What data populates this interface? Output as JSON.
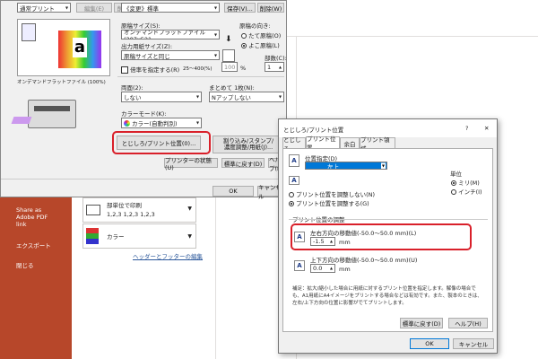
{
  "app": {
    "sidebar_items": [
      "Share as Adobe PDF link",
      "エクスポート",
      "閉じる"
    ],
    "print_options": [
      {
        "title": "部単位で印刷",
        "sub": "1,2,3   1,2,3   1,2,3"
      },
      {
        "title": "カラー",
        "sub": ""
      }
    ],
    "header_footer_link": "ヘッダーとフッターの編集"
  },
  "printer_dialog": {
    "top_select": "通常プリント",
    "edit_button": "編集(E)",
    "delete_button": "削除",
    "preset_select": "《変更》標準",
    "save_button": "保存(V)...",
    "delete2_button": "削除(W)",
    "paper_size_label": "原稿サイズ(S):",
    "paper_size_value": "オンデマンドフラットファイル (307x521",
    "orientation_label": "原稿の向き:",
    "orientation_portrait": "たて原稿(O)",
    "orientation_landscape": "よこ原稿(L)",
    "output_size_label": "出力用紙サイズ(Z):",
    "output_size_value": "原稿サイズと同じ",
    "scale_checkbox": "倍率を指定する(R)",
    "scale_range": "25〜400(%)",
    "scale_value": "100",
    "scale_unit": "%",
    "copies_label": "部数(C):",
    "copies_value": "1",
    "preview_caption": "オンデマンドフラットファイル (100%)",
    "duplex_label": "両面(2):",
    "duplex_value": "しない",
    "nup_label": "まとめて 1枚(N):",
    "nup_value": "Nアップしない",
    "color_mode_label": "カラーモード(K):",
    "color_mode_value": "カラー(自動判別)",
    "binding_button": "とじしろ/プリント位置(0)...",
    "stamp_button": "割り込み/スタンプ/\n濃度調整/用紙(J)...",
    "printer_status_button": "プリンターの状態(U)",
    "reset_button": "標準に戻す(D)",
    "help_button": "ヘルプ(H)",
    "ok_button": "OK",
    "cancel_button": "キャンセル"
  },
  "binding_dialog": {
    "title": "とじしろ/プリント位置",
    "help_glyph": "?",
    "close_glyph": "✕",
    "tabs": [
      "とじしろ",
      "プリント位置",
      "余白",
      "プリント領域"
    ],
    "active_tab": 1,
    "position_label": "位置指定(D)",
    "position_value": "左上",
    "unit_label": "単位",
    "unit_mm": "ミリ(M)",
    "unit_inch": "インチ(I)",
    "no_adjust": "プリント位置を調整しない(N)",
    "adjust": "プリント位置を調整する(G)",
    "adjust_group": "プリント位置の調整",
    "horizontal_label": "左右方向の移動値(-50.0〜50.0 mm)(L)",
    "horizontal_value": "-1.5",
    "vertical_label": "上下方向の移動値(-50.0〜50.0 mm)(U)",
    "vertical_value": "0.0",
    "mm_unit": "mm",
    "note": "補足：拡大/縮小した場合に用紙に対するプリント位置を指定します。解像の場合でも、A1用紙にA4イメージをプリントする場合などは有効です。また、製本のときは、左右/上下方向の位置に影響がでてプリントします。",
    "reset_button": "標準に戻す(D)",
    "help_button": "ヘルプ(H)",
    "ok_button": "OK",
    "cancel_button": "キャンセル"
  },
  "colors": {
    "accent": "#b7472a",
    "highlight": "#d9202a",
    "selected_blue": "#0078d7"
  }
}
